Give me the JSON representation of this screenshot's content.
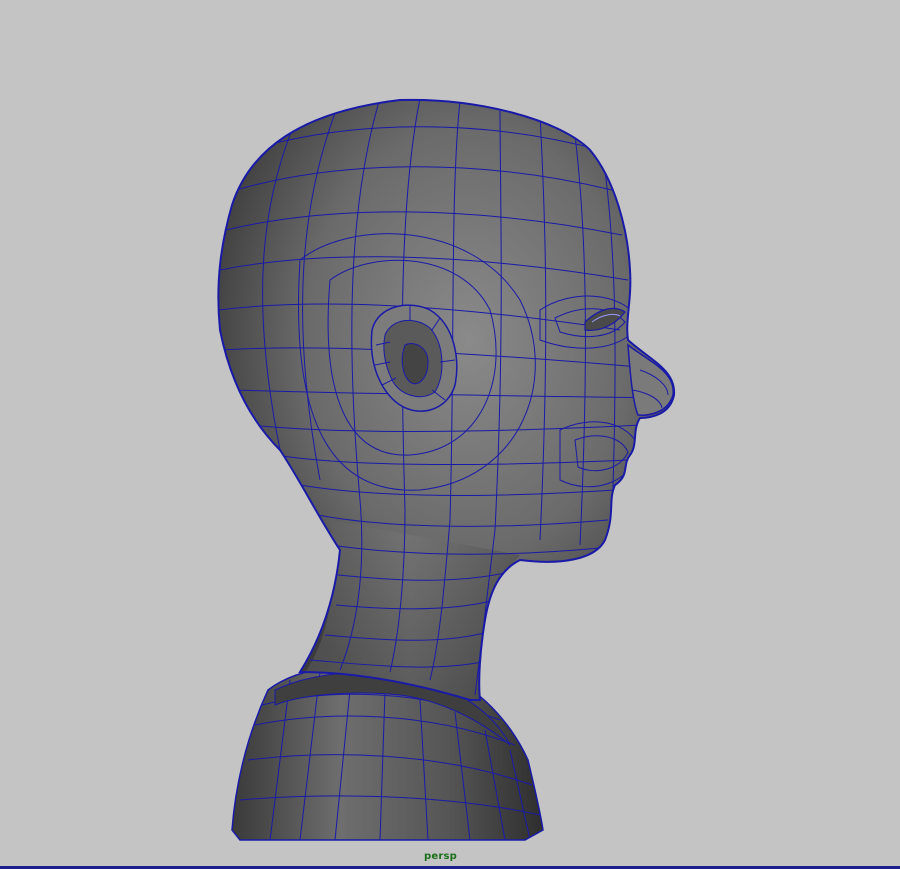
{
  "viewport": {
    "camera_label": "persp",
    "background_color": "#c4c4c4",
    "wireframe_color": "#1a1aa8",
    "mesh_color": "#6a6a6a",
    "border_color": "#1d1d8c"
  },
  "scene": {
    "object": "head-bust-mesh",
    "display_mode": "wireframe-on-shaded"
  }
}
